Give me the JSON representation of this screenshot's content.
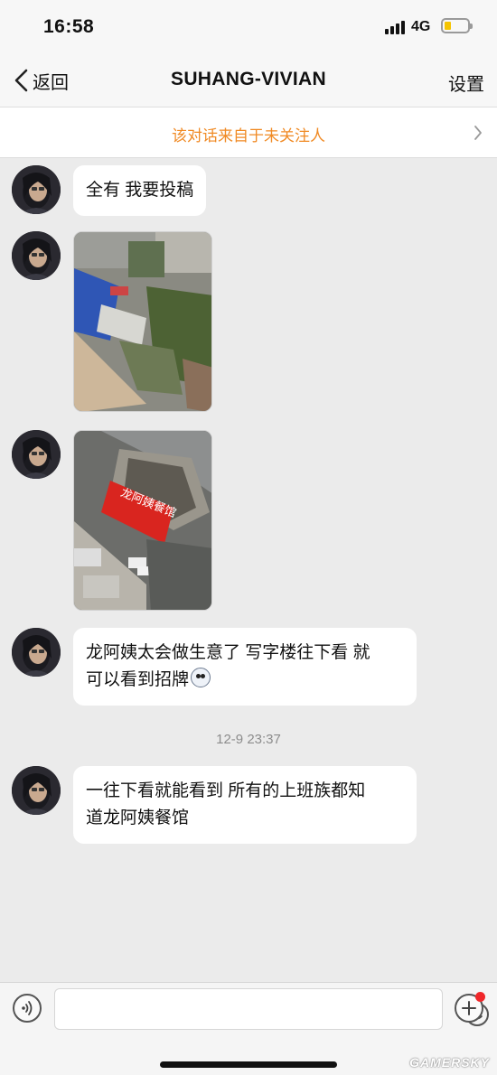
{
  "status_bar": {
    "time": "16:58",
    "network": "4G",
    "battery_level": 0.15,
    "battery_color": "#f5c400"
  },
  "nav": {
    "back_label": "返回",
    "title": "SUHANG-VIVIAN",
    "settings_label": "设置",
    "back_icon": "chevron-left-icon"
  },
  "notice": {
    "text": "该对话来自于未关注人",
    "color": "#f08a24",
    "icon": "chevron-right-icon"
  },
  "messages": [
    {
      "type": "text",
      "text": "全有 我要投稿"
    },
    {
      "type": "image",
      "description_icon": "photo-aerial-building"
    },
    {
      "type": "image",
      "description_icon": "photo-restaurant-sign",
      "sign_text": "龙阿姨餐馆"
    },
    {
      "type": "text",
      "line1": "龙阿姨太会做生意了 写字楼往下看 就",
      "line2": "可以看到招牌",
      "emoji": "shocked-face-icon"
    },
    {
      "type": "timestamp",
      "text": "12-9 23:37"
    },
    {
      "type": "text",
      "line1": "一往下看就能看到 所有的上班族都知",
      "line2": "道龙阿姨餐馆"
    }
  ],
  "input_bar": {
    "placeholder": "",
    "voice_icon": "voice-icon",
    "emoji_icon": "smiley-icon",
    "plus_icon": "plus-icon",
    "notification_color": "#f0272a"
  },
  "watermark": "GAMERSKY"
}
